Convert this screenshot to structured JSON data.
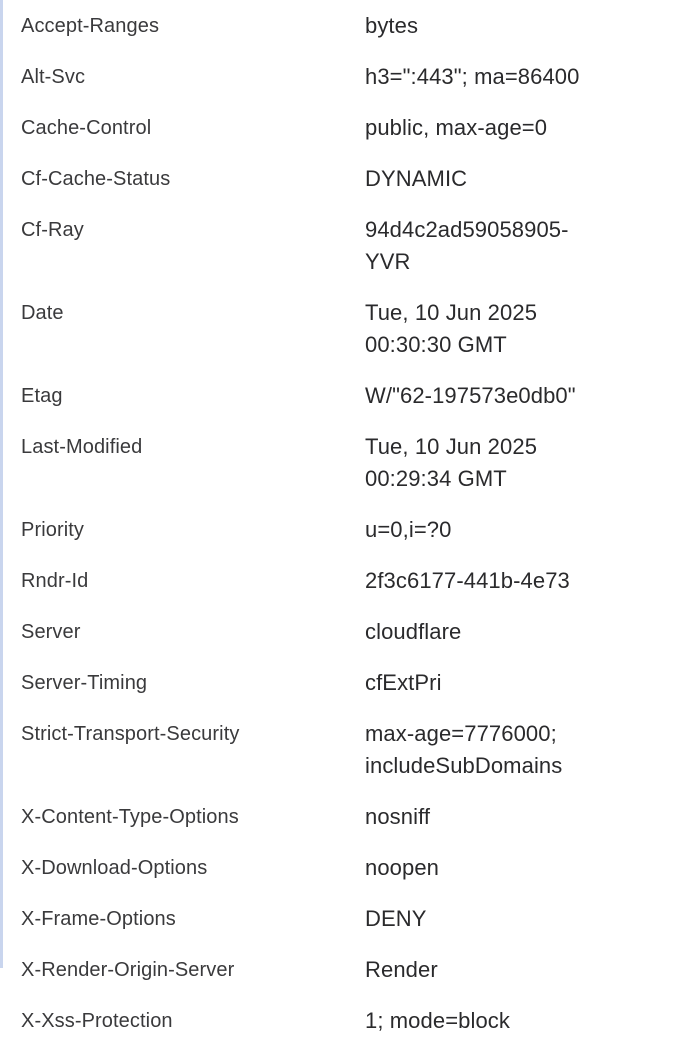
{
  "headers": [
    {
      "name": "Accept-Ranges",
      "value": [
        "bytes"
      ]
    },
    {
      "name": "Alt-Svc",
      "value": [
        "h3=\":443\"; ma=86400"
      ]
    },
    {
      "name": "Cache-Control",
      "value": [
        "public, max-age=0"
      ]
    },
    {
      "name": "Cf-Cache-Status",
      "value": [
        "DYNAMIC"
      ]
    },
    {
      "name": "Cf-Ray",
      "value": [
        "94d4c2ad59058905-",
        "YVR"
      ]
    },
    {
      "name": "Date",
      "value": [
        "Tue, 10 Jun 2025",
        "00:30:30 GMT"
      ]
    },
    {
      "name": "Etag",
      "value": [
        "W/\"62-197573e0db0\""
      ]
    },
    {
      "name": "Last-Modified",
      "value": [
        "Tue, 10 Jun 2025",
        "00:29:34 GMT"
      ]
    },
    {
      "name": "Priority",
      "value": [
        "u=0,i=?0"
      ]
    },
    {
      "name": "Rndr-Id",
      "value": [
        "2f3c6177-441b-4e73"
      ]
    },
    {
      "name": "Server",
      "value": [
        "cloudflare"
      ]
    },
    {
      "name": "Server-Timing",
      "value": [
        "cfExtPri"
      ]
    },
    {
      "name": "Strict-Transport-Security",
      "value": [
        "max-age=7776000;",
        "includeSubDomains"
      ]
    },
    {
      "name": "X-Content-Type-Options",
      "value": [
        "nosniff"
      ]
    },
    {
      "name": "X-Download-Options",
      "value": [
        "noopen"
      ]
    },
    {
      "name": "X-Frame-Options",
      "value": [
        "DENY"
      ]
    },
    {
      "name": "X-Render-Origin-Server",
      "value": [
        "Render"
      ]
    },
    {
      "name": "X-Xss-Protection",
      "value": [
        "1; mode=block"
      ]
    }
  ]
}
